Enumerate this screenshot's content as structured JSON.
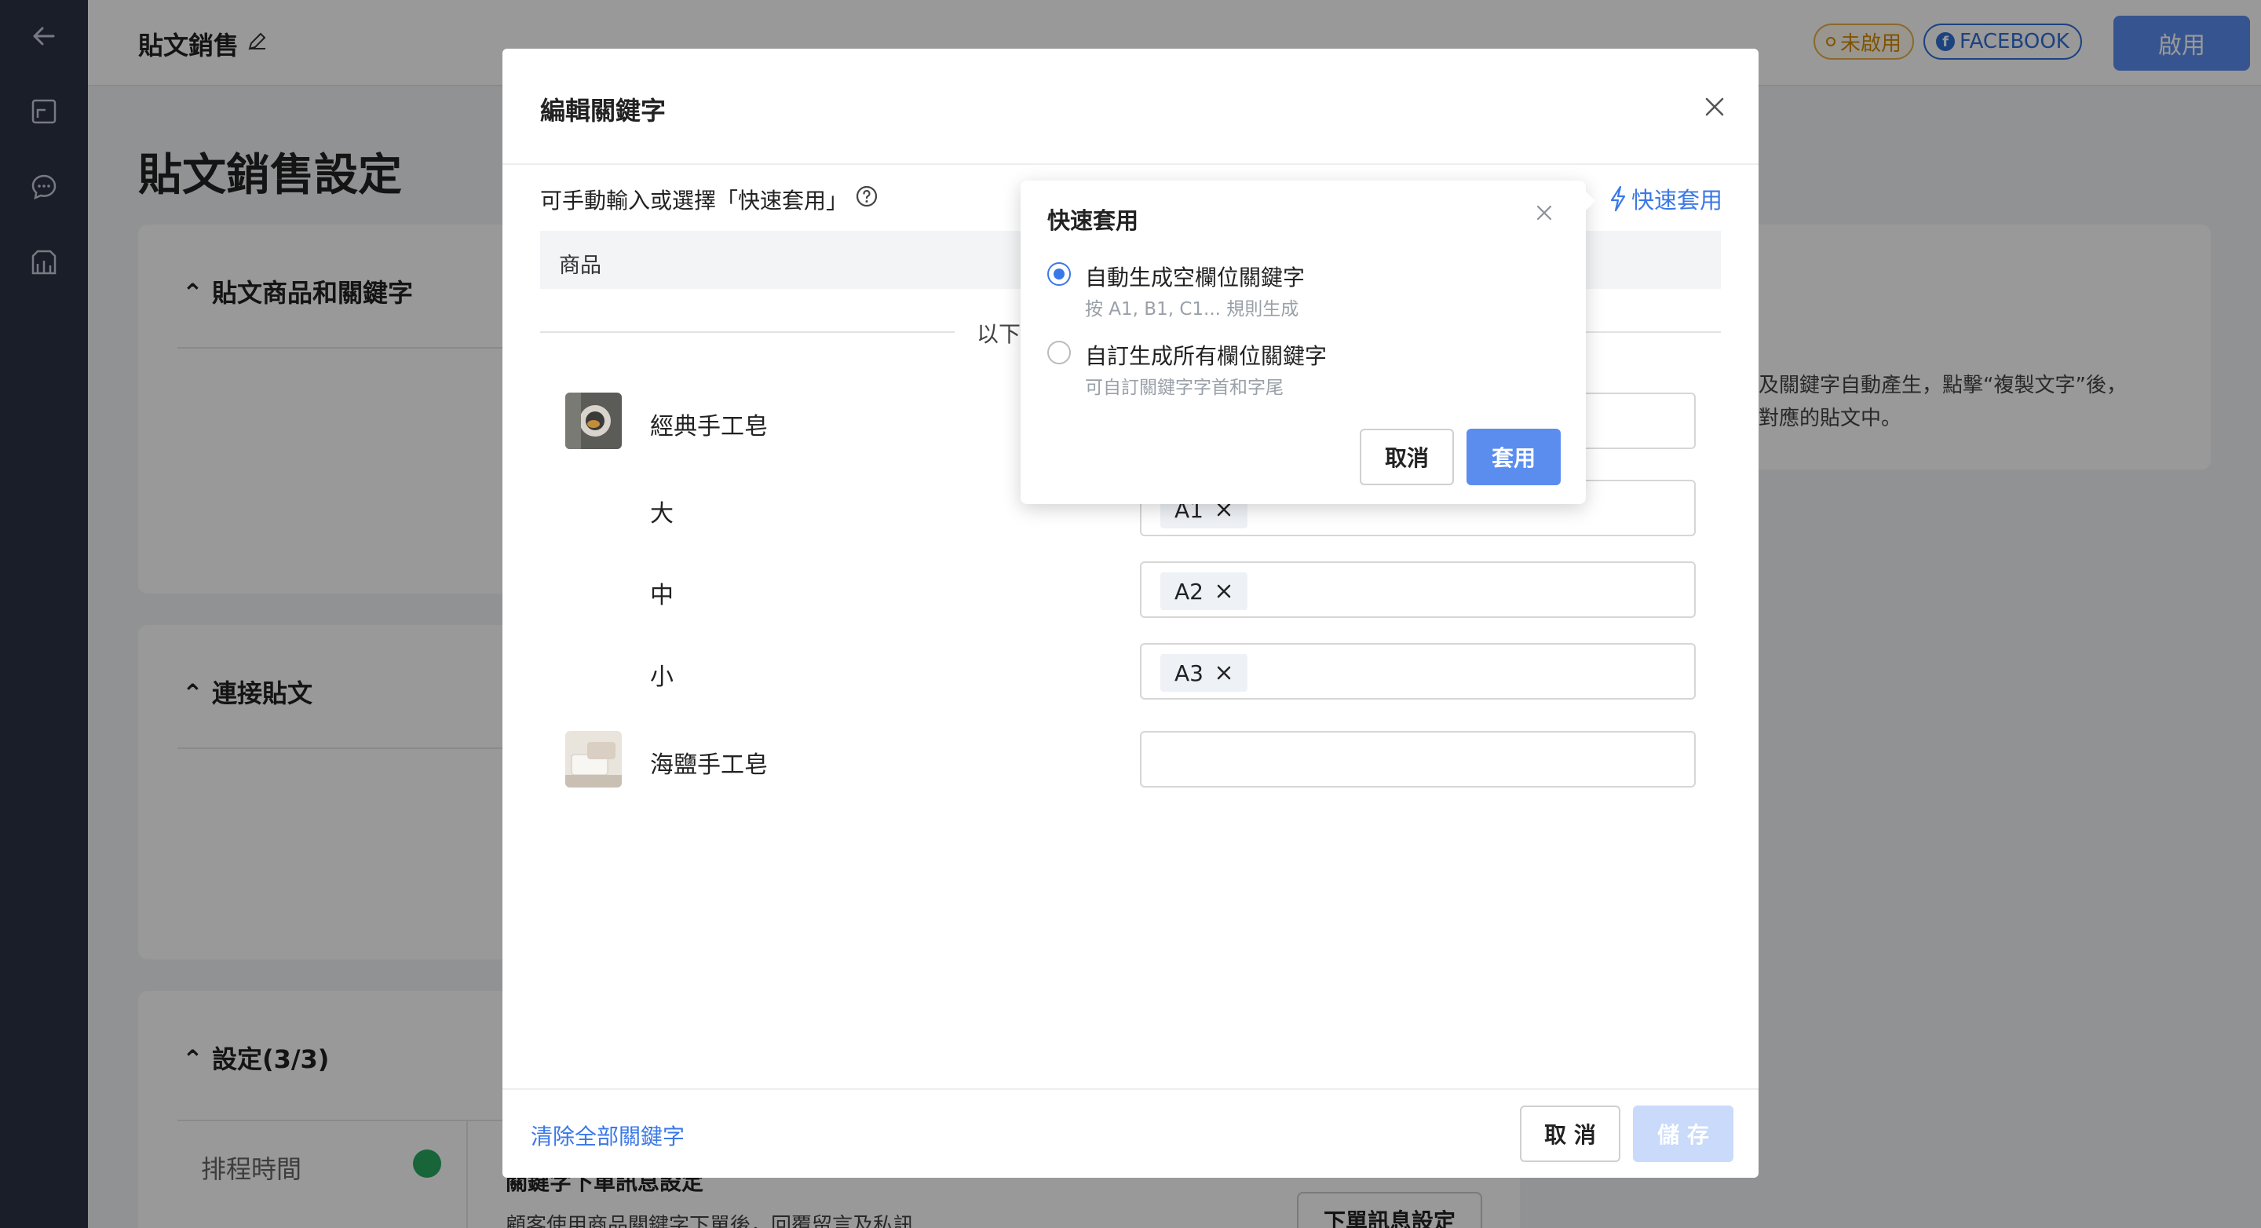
{
  "app": {
    "page_name": "貼文銷售",
    "status": "未啟用",
    "platform": "FACEBOOK",
    "enable_label": "啟用",
    "title": "貼文銷售設定"
  },
  "sidebar": {
    "icons": [
      "back-arrow-icon",
      "post-icon",
      "chat-icon",
      "shop-icon"
    ]
  },
  "sections": {
    "products_keywords": "貼文商品和關鍵字",
    "link_post": "連接貼文",
    "settings": "設定(3/3)",
    "schedule_label": "排程時間",
    "keyword_message_title": "關鍵字下單訊息設定",
    "keyword_message_desc": "顧客使用商品關鍵字下單後，回覆留言及私訊",
    "order_message_button": "下單訊息設定",
    "side_info_line1": "及關鍵字自動產生，點擊“複製文字”後，",
    "side_info_line2": "對應的貼文中。"
  },
  "modal": {
    "title": "編輯關鍵字",
    "hint": "可手動輸入或選擇「快速套用」",
    "quick_apply_link": "快速套用",
    "table_header_product": "商品",
    "separator_text": "以下",
    "products": [
      {
        "name": "經典手工皂",
        "keywords": []
      },
      {
        "name": "大",
        "keywords": [
          "A1"
        ]
      },
      {
        "name": "中",
        "keywords": [
          "A2"
        ]
      },
      {
        "name": "小",
        "keywords": [
          "A3"
        ]
      },
      {
        "name": "海鹽手工皂",
        "keywords": []
      }
    ],
    "clear_all": "清除全部關鍵字",
    "cancel": "取 消",
    "save": "儲 存"
  },
  "popover": {
    "title": "快速套用",
    "options": [
      {
        "label": "自動生成空欄位關鍵字",
        "sub": "按 A1, B1, C1... 規則生成",
        "selected": true
      },
      {
        "label": "自訂生成所有欄位關鍵字",
        "sub": "可自訂關鍵字字首和字尾",
        "selected": false
      }
    ],
    "cancel": "取消",
    "apply": "套用"
  },
  "colors": {
    "accent": "#3b78e7",
    "primary_button": "#5b8def",
    "sidebar": "#2b3344",
    "status_warning": "#d68a00",
    "success": "#27a85f"
  }
}
